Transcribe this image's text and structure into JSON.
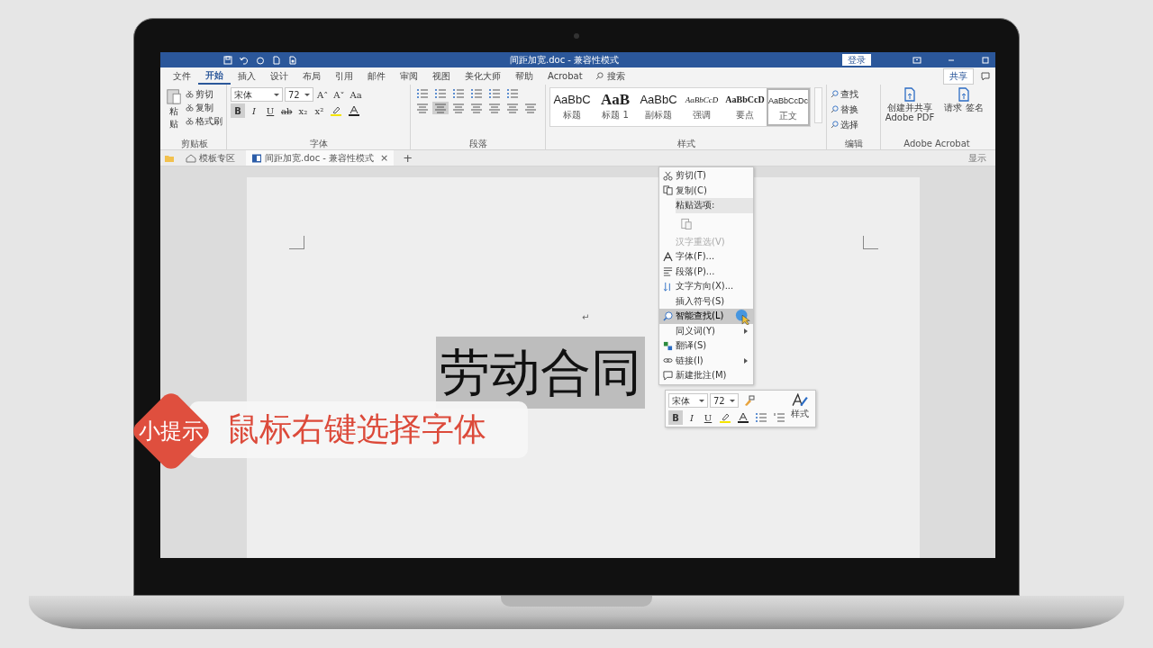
{
  "title_bar": {
    "title": "间距加宽.doc - 兼容性模式",
    "sign_in": "登录"
  },
  "ribbon_tabs": [
    {
      "label": "文件",
      "selected": false
    },
    {
      "label": "开始",
      "selected": true
    },
    {
      "label": "插入",
      "selected": false
    },
    {
      "label": "设计",
      "selected": false
    },
    {
      "label": "布局",
      "selected": false
    },
    {
      "label": "引用",
      "selected": false
    },
    {
      "label": "邮件",
      "selected": false
    },
    {
      "label": "审阅",
      "selected": false
    },
    {
      "label": "视图",
      "selected": false
    },
    {
      "label": "美化大师",
      "selected": false
    },
    {
      "label": "帮助",
      "selected": false
    },
    {
      "label": "Acrobat",
      "selected": false
    }
  ],
  "search": {
    "label": "搜索"
  },
  "share": {
    "label": "共享"
  },
  "clipboard": {
    "paste": "粘贴",
    "actions": [
      "剪切",
      "复制",
      "格式刷"
    ],
    "group": "剪贴板"
  },
  "font": {
    "name": "宋体",
    "size": "72",
    "size_buttons": [
      "A˄",
      "A˅",
      "Aa"
    ],
    "format_buttons": [
      {
        "label": "B",
        "kind": "bold",
        "selected": true
      },
      {
        "label": "I",
        "kind": "italic",
        "selected": false
      },
      {
        "label": "U",
        "kind": "underline",
        "selected": false
      },
      {
        "label": "ab",
        "kind": "strike",
        "selected": false
      },
      {
        "label": "x₂",
        "kind": "plain",
        "selected": false
      },
      {
        "label": "x²",
        "kind": "plain",
        "selected": false
      }
    ],
    "group": "字体"
  },
  "paragraph": {
    "group": "段落"
  },
  "styles": {
    "items": [
      {
        "sample": "AaBbC",
        "name": "标题",
        "kind": "title",
        "selected": false
      },
      {
        "sample": "AaB",
        "name": "标题 1",
        "kind": "heading",
        "selected": false
      },
      {
        "sample": "AaBbC",
        "name": "副标题",
        "kind": "subtitle",
        "selected": false
      },
      {
        "sample": "AaBbCcD",
        "name": "强调",
        "kind": "emphasis",
        "selected": false
      },
      {
        "sample": "AaBbCcD",
        "name": "要点",
        "kind": "strong",
        "selected": false
      },
      {
        "sample": "AaBbCcDc",
        "name": "正文",
        "kind": "normal",
        "selected": true
      }
    ],
    "group": "样式"
  },
  "editing": {
    "actions": [
      "查找",
      "替换",
      "选择"
    ],
    "group": "编辑"
  },
  "acrobat": {
    "actions": [
      "创建并共享 Adobe PDF",
      "请求 签名"
    ],
    "group": "Adobe Acrobat"
  },
  "doc_tabs": {
    "template": "模板专区",
    "document": "间距加宽.doc - 兼容性模式",
    "close": "×",
    "add": "+",
    "display": "显示"
  },
  "document": {
    "heading": "劳动合同",
    "heading_selected": true,
    "paragraph_mark": "↵"
  },
  "context_menu": [
    {
      "label": "剪切(T)",
      "kind": "cut",
      "disabled": false,
      "selected": false,
      "submenu": false
    },
    {
      "label": "复制(C)",
      "kind": "copy",
      "disabled": false,
      "selected": false,
      "submenu": false
    },
    {
      "label": "粘贴选项:",
      "kind": "header",
      "disabled": false,
      "selected": false,
      "submenu": false
    },
    {
      "label": "汉字重选(V)",
      "kind": "reselect",
      "disabled": true,
      "selected": false,
      "submenu": false
    },
    {
      "label": "字体(F)...",
      "kind": "font",
      "disabled": false,
      "selected": false,
      "submenu": false
    },
    {
      "label": "段落(P)...",
      "kind": "paragraph",
      "disabled": false,
      "selected": false,
      "submenu": false
    },
    {
      "label": "文字方向(X)...",
      "kind": "direction",
      "disabled": false,
      "selected": false,
      "submenu": false
    },
    {
      "label": "插入符号(S)",
      "kind": "symbol",
      "disabled": false,
      "selected": false,
      "submenu": false
    },
    {
      "label": "智能查找(L)",
      "kind": "lookup",
      "disabled": false,
      "selected": true,
      "submenu": false
    },
    {
      "label": "同义词(Y)",
      "kind": "synonym",
      "disabled": false,
      "selected": false,
      "submenu": true
    },
    {
      "label": "翻译(S)",
      "kind": "translate",
      "disabled": false,
      "selected": false,
      "submenu": false
    },
    {
      "label": "链接(I)",
      "kind": "link",
      "disabled": false,
      "selected": false,
      "submenu": true
    },
    {
      "label": "新建批注(M)",
      "kind": "comment",
      "disabled": false,
      "selected": false,
      "submenu": false
    }
  ],
  "mini_toolbar": {
    "font": "宋体",
    "size": "72",
    "styles": "样式",
    "format_buttons": [
      {
        "label": "B",
        "kind": "bold",
        "selected": true
      },
      {
        "label": "I",
        "kind": "italic",
        "selected": false
      },
      {
        "label": "U",
        "kind": "underline",
        "selected": false
      }
    ]
  },
  "tip": {
    "badge": "小提示",
    "text": "鼠标右键选择字体"
  }
}
